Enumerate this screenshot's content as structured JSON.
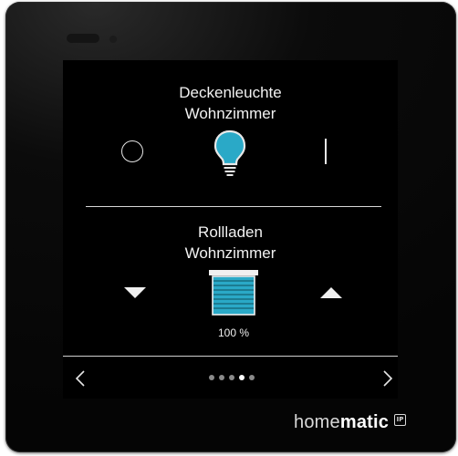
{
  "light": {
    "name_line1": "Deckenleuchte",
    "name_line2": "Wohnzimmer",
    "state": "on",
    "accent_color": "#2aa9c7",
    "off_icon": "circle-off-icon",
    "on_icon": "bar-on-icon"
  },
  "shutter": {
    "name_line1": "Rollladen",
    "name_line2": "Wohnzimmer",
    "level_text": "100 %",
    "level_fraction": 1.0,
    "accent_color": "#2aa9c7"
  },
  "pager": {
    "total": 5,
    "active_index": 3
  },
  "brand": {
    "name_regular": "home",
    "name_bold": "matic",
    "badge": "IP"
  }
}
